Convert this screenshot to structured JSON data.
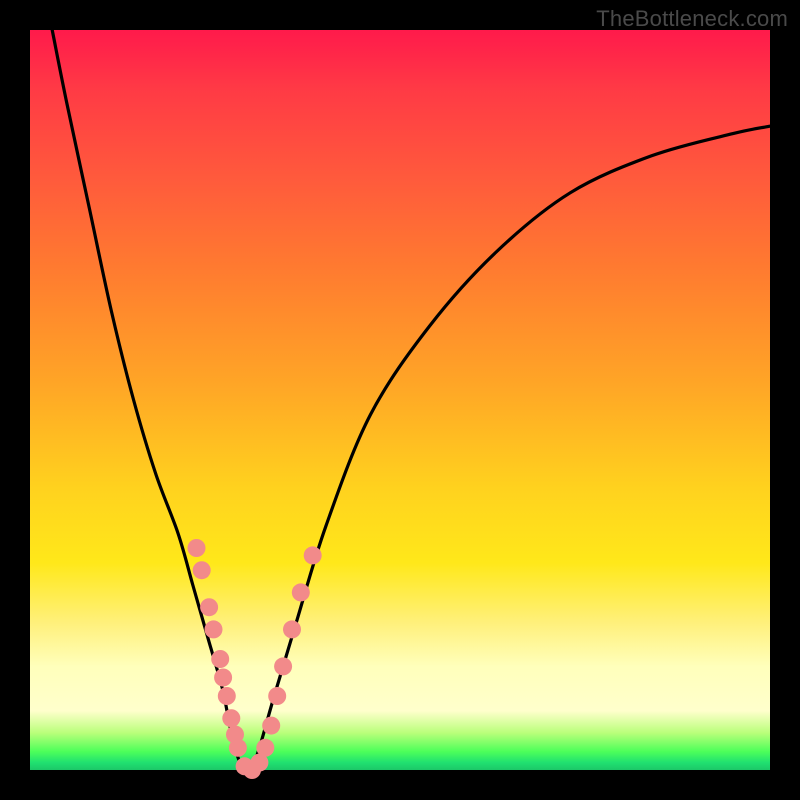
{
  "watermark": "TheBottleneck.com",
  "colors": {
    "frame": "#000000",
    "curve": "#000000",
    "dot_fill": "#f28a8a",
    "dot_stroke": "#d86e6e"
  },
  "chart_data": {
    "type": "line",
    "title": "",
    "xlabel": "",
    "ylabel": "",
    "xlim": [
      0,
      100
    ],
    "ylim": [
      0,
      100
    ],
    "series": [
      {
        "name": "bottleneck-curve",
        "x": [
          3,
          5,
          8,
          11,
          14,
          17,
          20,
          22,
          24,
          26,
          27,
          28,
          29,
          30,
          31,
          33,
          36,
          40,
          46,
          54,
          63,
          73,
          84,
          95,
          100
        ],
        "y": [
          100,
          90,
          76,
          62,
          50,
          40,
          32,
          25,
          18,
          11,
          6,
          2,
          0,
          0.5,
          3,
          10,
          20,
          33,
          48,
          60,
          70,
          78,
          83,
          86,
          87
        ]
      }
    ],
    "dots": {
      "name": "highlight-points",
      "points": [
        {
          "x": 22.5,
          "y": 30
        },
        {
          "x": 23.2,
          "y": 27
        },
        {
          "x": 24.2,
          "y": 22
        },
        {
          "x": 24.8,
          "y": 19
        },
        {
          "x": 25.7,
          "y": 15
        },
        {
          "x": 26.1,
          "y": 12.5
        },
        {
          "x": 26.6,
          "y": 10
        },
        {
          "x": 27.2,
          "y": 7
        },
        {
          "x": 27.7,
          "y": 4.8
        },
        {
          "x": 28.1,
          "y": 3
        },
        {
          "x": 29.0,
          "y": 0.5
        },
        {
          "x": 30.0,
          "y": 0
        },
        {
          "x": 31.0,
          "y": 1
        },
        {
          "x": 31.8,
          "y": 3
        },
        {
          "x": 32.6,
          "y": 6
        },
        {
          "x": 33.4,
          "y": 10
        },
        {
          "x": 34.2,
          "y": 14
        },
        {
          "x": 35.4,
          "y": 19
        },
        {
          "x": 36.6,
          "y": 24
        },
        {
          "x": 38.2,
          "y": 29
        }
      ]
    }
  }
}
